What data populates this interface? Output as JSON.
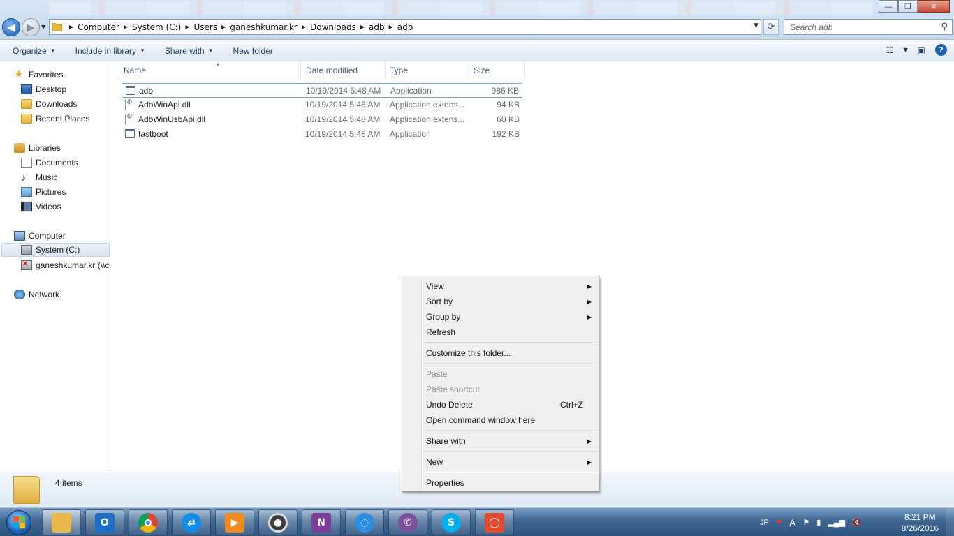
{
  "window": {
    "minimize_glyph": "—",
    "maximize_glyph": "❐",
    "close_glyph": "✕"
  },
  "address_bar": {
    "breadcrumbs": [
      "Computer",
      "System (C:)",
      "Users",
      "ganeshkumar.kr",
      "Downloads",
      "adb",
      "adb"
    ]
  },
  "search": {
    "placeholder": "Search adb"
  },
  "toolbar": {
    "organize": "Organize",
    "include_in_library": "Include in library",
    "share_with": "Share with",
    "new_folder": "New folder",
    "help": "?"
  },
  "nav": {
    "favorites": "Favorites",
    "desktop": "Desktop",
    "downloads": "Downloads",
    "recent_places": "Recent Places",
    "libraries": "Libraries",
    "documents": "Documents",
    "music": "Music",
    "pictures": "Pictures",
    "videos": "Videos",
    "computer": "Computer",
    "system_c": "System (C:)",
    "network_drive": "ganeshkumar.kr (\\\\c",
    "network": "Network"
  },
  "columns": {
    "name": "Name",
    "date": "Date modified",
    "type": "Type",
    "size": "Size"
  },
  "files": [
    {
      "name": "adb",
      "date": "10/19/2014 5:48 AM",
      "type": "Application",
      "size": "986 KB",
      "icon": "app-icon"
    },
    {
      "name": "AdbWinApi.dll",
      "date": "10/19/2014 5:48 AM",
      "type": "Application extens...",
      "size": "94 KB",
      "icon": "dll-icon"
    },
    {
      "name": "AdbWinUsbApi.dll",
      "date": "10/19/2014 5:48 AM",
      "type": "Application extens...",
      "size": "60 KB",
      "icon": "dll-icon"
    },
    {
      "name": "fastboot",
      "date": "10/19/2014 5:48 AM",
      "type": "Application",
      "size": "192 KB",
      "icon": "app-icon"
    }
  ],
  "details": {
    "item_count": "4 items"
  },
  "context_menu": {
    "view": "View",
    "sort_by": "Sort by",
    "group_by": "Group by",
    "refresh": "Refresh",
    "customize": "Customize this folder...",
    "paste": "Paste",
    "paste_shortcut": "Paste shortcut",
    "undo_delete": "Undo Delete",
    "undo_shortcut": "Ctrl+Z",
    "open_cmd": "Open command window here",
    "share_with": "Share with",
    "new": "New",
    "properties": "Properties"
  },
  "taskbar": {
    "apps": [
      {
        "id": "explorer",
        "icon": "folder-icon",
        "color": "#e8b94a"
      },
      {
        "id": "outlook",
        "icon": "outlook-icon",
        "color": "#1a6fc4",
        "glyph": "O"
      },
      {
        "id": "chrome",
        "icon": "chrome-icon",
        "color": "#db4437"
      },
      {
        "id": "teamviewer",
        "icon": "teamviewer-icon",
        "color": "#0e8ee9"
      },
      {
        "id": "media",
        "icon": "media-player-icon",
        "color": "#f28a1b"
      },
      {
        "id": "disc",
        "icon": "disc-icon",
        "color": "#3c3c3c"
      },
      {
        "id": "onenote",
        "icon": "onenote-icon",
        "color": "#7d3c98",
        "glyph": "N"
      },
      {
        "id": "chat",
        "icon": "chat-icon",
        "color": "#2b8ee2"
      },
      {
        "id": "viber",
        "icon": "viber-icon",
        "color": "#7b519d"
      },
      {
        "id": "skype",
        "icon": "skype-icon",
        "color": "#00aff0",
        "glyph": "S"
      },
      {
        "id": "recorder",
        "icon": "recorder-icon",
        "color": "#e8492b"
      }
    ],
    "tray": {
      "language": "JP",
      "time": "8:21 PM",
      "date": "8/26/2016"
    }
  }
}
